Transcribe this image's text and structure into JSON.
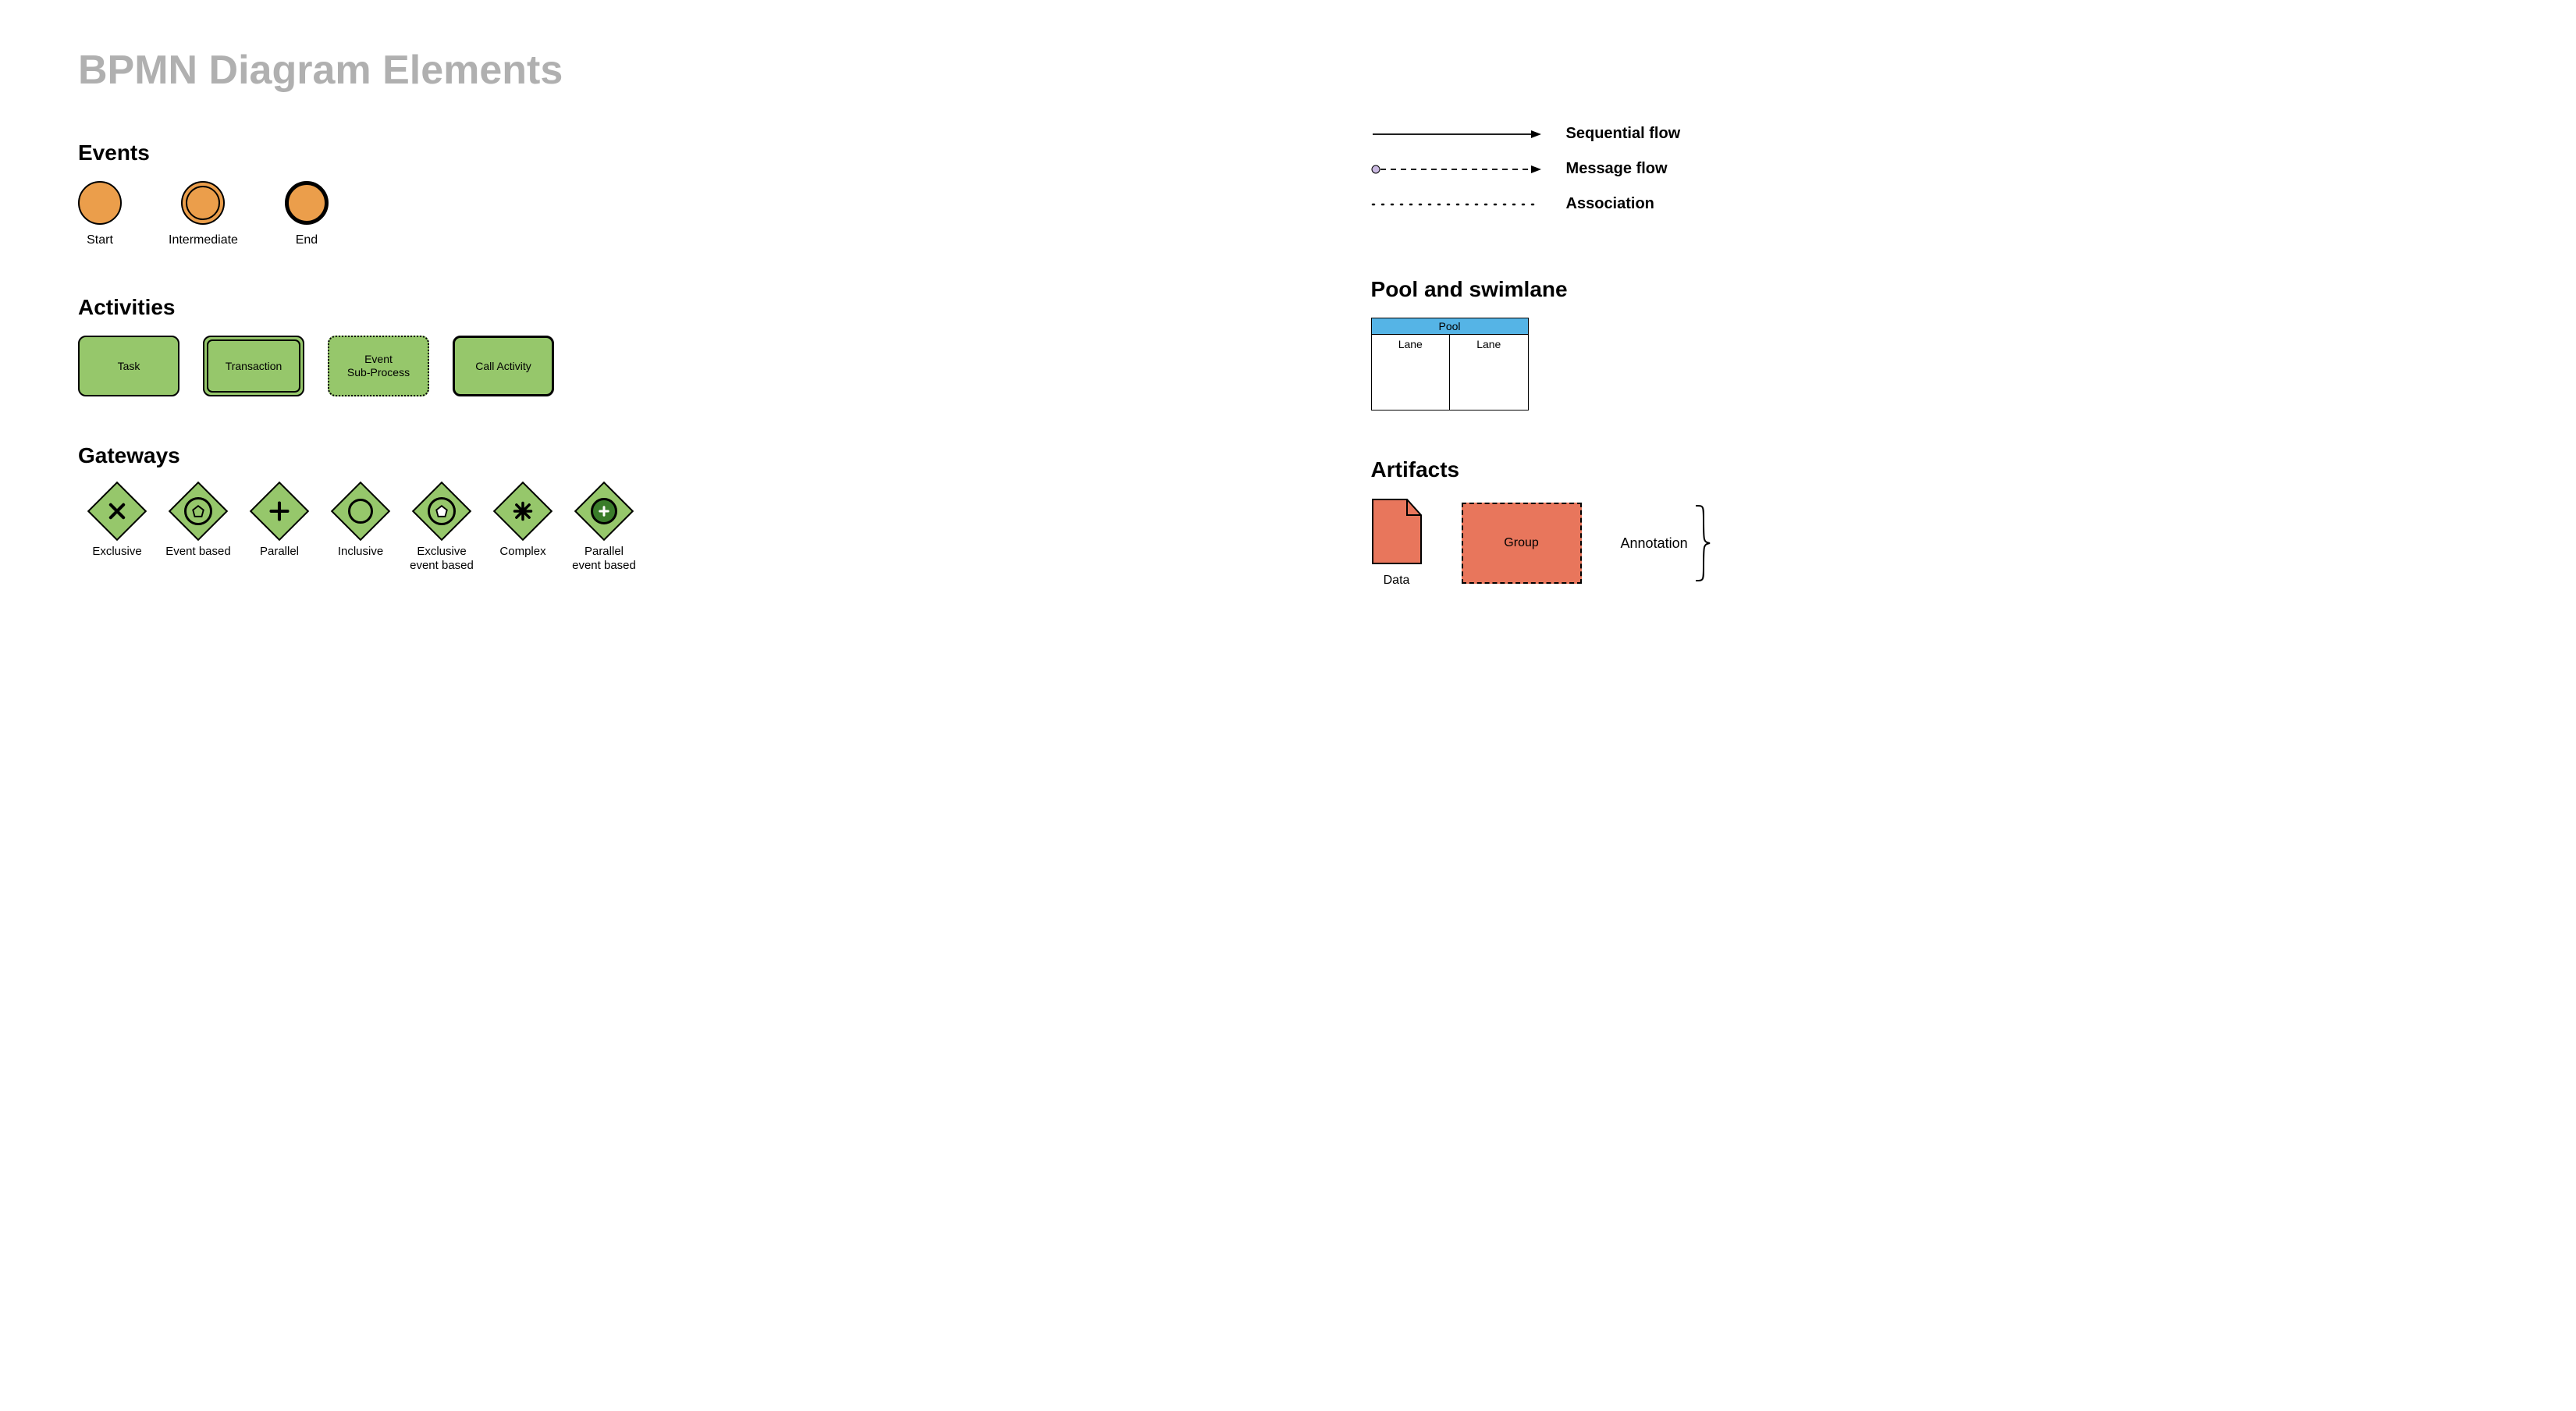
{
  "title": "BPMN Diagram Elements",
  "sections": {
    "events": {
      "heading": "Events",
      "items": {
        "start": "Start",
        "intermediate": "Intermediate",
        "end": "End"
      }
    },
    "activities": {
      "heading": "Activities",
      "items": {
        "task": "Task",
        "transaction": "Transaction",
        "event_sub": "Event\nSub-Process",
        "call": "Call Activity"
      }
    },
    "gateways": {
      "heading": "Gateways",
      "items": {
        "exclusive": "Exclusive",
        "event_based": "Event based",
        "parallel": "Parallel",
        "inclusive": "Inclusive",
        "excl_event_based": "Exclusive\nevent based",
        "complex": "Complex",
        "par_event_based": "Parallel\nevent based"
      }
    },
    "flows": {
      "sequential": "Sequential flow",
      "message": "Message flow",
      "association": "Association"
    },
    "pool": {
      "heading": "Pool and swimlane",
      "pool_label": "Pool",
      "lane1": "Lane",
      "lane2": "Lane"
    },
    "artifacts": {
      "heading": "Artifacts",
      "data": "Data",
      "group": "Group",
      "annotation": "Annotation"
    }
  },
  "colors": {
    "event_fill": "#eb9e4b",
    "activity_fill": "#96c76b",
    "pool_header": "#55b4e6",
    "artifact_fill": "#e8765c",
    "title_grey": "#b0b0b0"
  }
}
